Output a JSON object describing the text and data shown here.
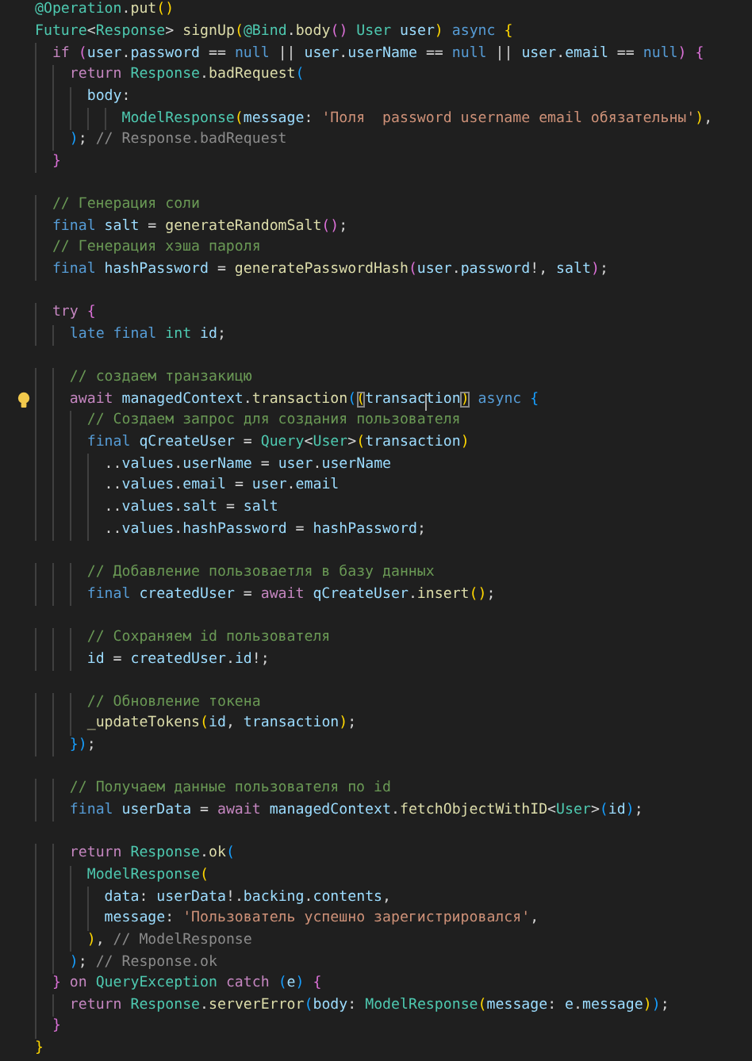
{
  "editor": {
    "lines": [
      {
        "kind": "code",
        "tokens": [
          {
            "text": "@Operation",
            "kind": "ty"
          },
          {
            "text": ".",
            "kind": "p"
          },
          {
            "text": "put",
            "kind": "fn"
          },
          {
            "text": "()",
            "kind": "b1"
          }
        ]
      },
      {
        "kind": "code",
        "tokens": [
          {
            "text": "Future",
            "kind": "ty"
          },
          {
            "text": "<",
            "kind": "p"
          },
          {
            "text": "Response",
            "kind": "ty"
          },
          {
            "text": "> ",
            "kind": "p"
          },
          {
            "text": "signUp",
            "kind": "fn"
          },
          {
            "text": "(",
            "kind": "b1"
          },
          {
            "text": "@Bind",
            "kind": "ty"
          },
          {
            "text": ".",
            "kind": "p"
          },
          {
            "text": "body",
            "kind": "fn"
          },
          {
            "text": "()",
            "kind": "b2"
          },
          {
            "text": " User",
            "kind": "ty"
          },
          {
            "text": " user",
            "kind": "var"
          },
          {
            "text": ")",
            "kind": "b1"
          },
          {
            "text": " async",
            "kind": "st"
          },
          {
            "text": " {",
            "kind": "b1"
          }
        ]
      },
      {
        "kind": "code",
        "tokens": [
          {
            "text": "  if",
            "kind": "kw"
          },
          {
            "text": " (",
            "kind": "b2"
          },
          {
            "text": "user",
            "kind": "var"
          },
          {
            "text": ".",
            "kind": "p"
          },
          {
            "text": "password",
            "kind": "var"
          },
          {
            "text": " ==",
            "kind": "p"
          },
          {
            "text": " null",
            "kind": "st"
          },
          {
            "text": " ||",
            "kind": "p"
          },
          {
            "text": " user",
            "kind": "var"
          },
          {
            "text": ".",
            "kind": "p"
          },
          {
            "text": "userName",
            "kind": "var"
          },
          {
            "text": " ==",
            "kind": "p"
          },
          {
            "text": " null",
            "kind": "st"
          },
          {
            "text": " ||",
            "kind": "p"
          },
          {
            "text": " user",
            "kind": "var"
          },
          {
            "text": ".",
            "kind": "p"
          },
          {
            "text": "email",
            "kind": "var"
          },
          {
            "text": " ==",
            "kind": "p"
          },
          {
            "text": " null",
            "kind": "st"
          },
          {
            "text": ")",
            "kind": "b2"
          },
          {
            "text": " {",
            "kind": "b2"
          }
        ]
      },
      {
        "kind": "code",
        "tokens": [
          {
            "text": "    return",
            "kind": "kw"
          },
          {
            "text": " Response",
            "kind": "ty"
          },
          {
            "text": ".",
            "kind": "p"
          },
          {
            "text": "badRequest",
            "kind": "fn"
          },
          {
            "text": "(",
            "kind": "b3"
          }
        ]
      },
      {
        "kind": "code",
        "tokens": [
          {
            "text": "      body",
            "kind": "var"
          },
          {
            "text": ":",
            "kind": "p"
          }
        ]
      },
      {
        "kind": "code",
        "tokens": [
          {
            "text": "          ModelResponse",
            "kind": "ty"
          },
          {
            "text": "(",
            "kind": "b1"
          },
          {
            "text": "message",
            "kind": "var"
          },
          {
            "text": ":",
            "kind": "p"
          },
          {
            "text": " 'Поля  password username email обязательны'",
            "kind": "str"
          },
          {
            "text": ")",
            "kind": "b1"
          },
          {
            "text": ",",
            "kind": "p"
          }
        ]
      },
      {
        "kind": "code",
        "tokens": [
          {
            "text": "    )",
            "kind": "b3"
          },
          {
            "text": ";",
            "kind": "p"
          },
          {
            "text": " // Response.badRequest",
            "kind": "hint"
          }
        ]
      },
      {
        "kind": "code",
        "tokens": [
          {
            "text": "  }",
            "kind": "b2"
          }
        ]
      },
      {
        "kind": "blank"
      },
      {
        "kind": "code",
        "tokens": [
          {
            "text": "  // Генерация соли",
            "kind": "cm"
          }
        ]
      },
      {
        "kind": "code",
        "tokens": [
          {
            "text": "  final",
            "kind": "st"
          },
          {
            "text": " salt",
            "kind": "var"
          },
          {
            "text": " =",
            "kind": "p"
          },
          {
            "text": " generateRandomSalt",
            "kind": "fn"
          },
          {
            "text": "()",
            "kind": "b2"
          },
          {
            "text": ";",
            "kind": "p"
          }
        ]
      },
      {
        "kind": "code",
        "tokens": [
          {
            "text": "  // Генерация хэша пароля",
            "kind": "cm"
          }
        ]
      },
      {
        "kind": "code",
        "tokens": [
          {
            "text": "  final",
            "kind": "st"
          },
          {
            "text": " hashPassword",
            "kind": "var"
          },
          {
            "text": " =",
            "kind": "p"
          },
          {
            "text": " generatePasswordHash",
            "kind": "fn"
          },
          {
            "text": "(",
            "kind": "b2"
          },
          {
            "text": "user",
            "kind": "var"
          },
          {
            "text": ".",
            "kind": "p"
          },
          {
            "text": "password",
            "kind": "var"
          },
          {
            "text": "!,",
            "kind": "p"
          },
          {
            "text": " salt",
            "kind": "var"
          },
          {
            "text": ")",
            "kind": "b2"
          },
          {
            "text": ";",
            "kind": "p"
          }
        ]
      },
      {
        "kind": "blank"
      },
      {
        "kind": "code",
        "tokens": [
          {
            "text": "  try",
            "kind": "kw"
          },
          {
            "text": " {",
            "kind": "b2"
          }
        ]
      },
      {
        "kind": "code",
        "tokens": [
          {
            "text": "    late",
            "kind": "st"
          },
          {
            "text": " final",
            "kind": "st"
          },
          {
            "text": " int",
            "kind": "ty"
          },
          {
            "text": " id",
            "kind": "var"
          },
          {
            "text": ";",
            "kind": "p"
          }
        ]
      },
      {
        "kind": "blank"
      },
      {
        "kind": "code",
        "tokens": [
          {
            "text": "    // создаем транзакицю",
            "kind": "cm"
          }
        ]
      },
      {
        "kind": "code",
        "bulb": true,
        "tokens": [
          {
            "text": "    await",
            "kind": "kw"
          },
          {
            "text": " managedContext",
            "kind": "var"
          },
          {
            "text": ".",
            "kind": "p"
          },
          {
            "text": "transaction",
            "kind": "fn"
          },
          {
            "text": "(",
            "kind": "b3"
          },
          {
            "text": "(",
            "kind": "b1",
            "boxed": true
          },
          {
            "text": "transac",
            "kind": "var",
            "caret_after": true
          },
          {
            "text": "tion",
            "kind": "var"
          },
          {
            "text": ")",
            "kind": "b1",
            "boxed": true
          },
          {
            "text": " async",
            "kind": "st"
          },
          {
            "text": " {",
            "kind": "b3"
          }
        ]
      },
      {
        "kind": "code",
        "tokens": [
          {
            "text": "      // Создаем запрос для создания пользователя",
            "kind": "cm"
          }
        ]
      },
      {
        "kind": "code",
        "tokens": [
          {
            "text": "      final",
            "kind": "st"
          },
          {
            "text": " qCreateUser",
            "kind": "var"
          },
          {
            "text": " =",
            "kind": "p"
          },
          {
            "text": " Query",
            "kind": "ty"
          },
          {
            "text": "<",
            "kind": "p"
          },
          {
            "text": "User",
            "kind": "ty"
          },
          {
            "text": ">",
            "kind": "p"
          },
          {
            "text": "(",
            "kind": "b1"
          },
          {
            "text": "transaction",
            "kind": "var"
          },
          {
            "text": ")",
            "kind": "b1"
          }
        ]
      },
      {
        "kind": "code",
        "tokens": [
          {
            "text": "        ..",
            "kind": "p"
          },
          {
            "text": "values",
            "kind": "var"
          },
          {
            "text": ".",
            "kind": "p"
          },
          {
            "text": "userName",
            "kind": "var"
          },
          {
            "text": " =",
            "kind": "p"
          },
          {
            "text": " user",
            "kind": "var"
          },
          {
            "text": ".",
            "kind": "p"
          },
          {
            "text": "userName",
            "kind": "var"
          }
        ]
      },
      {
        "kind": "code",
        "tokens": [
          {
            "text": "        ..",
            "kind": "p"
          },
          {
            "text": "values",
            "kind": "var"
          },
          {
            "text": ".",
            "kind": "p"
          },
          {
            "text": "email",
            "kind": "var"
          },
          {
            "text": " =",
            "kind": "p"
          },
          {
            "text": " user",
            "kind": "var"
          },
          {
            "text": ".",
            "kind": "p"
          },
          {
            "text": "email",
            "kind": "var"
          }
        ]
      },
      {
        "kind": "code",
        "tokens": [
          {
            "text": "        ..",
            "kind": "p"
          },
          {
            "text": "values",
            "kind": "var"
          },
          {
            "text": ".",
            "kind": "p"
          },
          {
            "text": "salt",
            "kind": "var"
          },
          {
            "text": " =",
            "kind": "p"
          },
          {
            "text": " salt",
            "kind": "var"
          }
        ]
      },
      {
        "kind": "code",
        "tokens": [
          {
            "text": "        ..",
            "kind": "p"
          },
          {
            "text": "values",
            "kind": "var"
          },
          {
            "text": ".",
            "kind": "p"
          },
          {
            "text": "hashPassword",
            "kind": "var"
          },
          {
            "text": " =",
            "kind": "p"
          },
          {
            "text": " hashPassword",
            "kind": "var"
          },
          {
            "text": ";",
            "kind": "p"
          }
        ]
      },
      {
        "kind": "blank"
      },
      {
        "kind": "code",
        "tokens": [
          {
            "text": "      // Добавление пользоваетля в базу данных",
            "kind": "cm"
          }
        ]
      },
      {
        "kind": "code",
        "tokens": [
          {
            "text": "      final",
            "kind": "st"
          },
          {
            "text": " createdUser",
            "kind": "var"
          },
          {
            "text": " =",
            "kind": "p"
          },
          {
            "text": " await",
            "kind": "kw"
          },
          {
            "text": " qCreateUser",
            "kind": "var"
          },
          {
            "text": ".",
            "kind": "p"
          },
          {
            "text": "insert",
            "kind": "fn"
          },
          {
            "text": "()",
            "kind": "b1"
          },
          {
            "text": ";",
            "kind": "p"
          }
        ]
      },
      {
        "kind": "blank"
      },
      {
        "kind": "code",
        "tokens": [
          {
            "text": "      // Сохраняем id пользователя",
            "kind": "cm"
          }
        ]
      },
      {
        "kind": "code",
        "tokens": [
          {
            "text": "      id",
            "kind": "var"
          },
          {
            "text": " =",
            "kind": "p"
          },
          {
            "text": " createdUser",
            "kind": "var"
          },
          {
            "text": ".",
            "kind": "p"
          },
          {
            "text": "id",
            "kind": "var"
          },
          {
            "text": "!;",
            "kind": "p"
          }
        ]
      },
      {
        "kind": "blank"
      },
      {
        "kind": "code",
        "tokens": [
          {
            "text": "      // Обновление токена",
            "kind": "cm"
          }
        ]
      },
      {
        "kind": "code",
        "tokens": [
          {
            "text": "      _updateTokens",
            "kind": "fn"
          },
          {
            "text": "(",
            "kind": "b1"
          },
          {
            "text": "id",
            "kind": "var"
          },
          {
            "text": ",",
            "kind": "p"
          },
          {
            "text": " transaction",
            "kind": "var"
          },
          {
            "text": ")",
            "kind": "b1"
          },
          {
            "text": ";",
            "kind": "p"
          }
        ]
      },
      {
        "kind": "code",
        "tokens": [
          {
            "text": "    }",
            "kind": "b3"
          },
          {
            "text": ")",
            "kind": "b3"
          },
          {
            "text": ";",
            "kind": "p"
          }
        ]
      },
      {
        "kind": "blank"
      },
      {
        "kind": "code",
        "tokens": [
          {
            "text": "    // Получаем данные пользователя по id",
            "kind": "cm"
          }
        ]
      },
      {
        "kind": "code",
        "tokens": [
          {
            "text": "    final",
            "kind": "st"
          },
          {
            "text": " userData",
            "kind": "var"
          },
          {
            "text": " =",
            "kind": "p"
          },
          {
            "text": " await",
            "kind": "kw"
          },
          {
            "text": " managedContext",
            "kind": "var"
          },
          {
            "text": ".",
            "kind": "p"
          },
          {
            "text": "fetchObjectWithID",
            "kind": "fn"
          },
          {
            "text": "<",
            "kind": "p"
          },
          {
            "text": "User",
            "kind": "ty"
          },
          {
            "text": ">",
            "kind": "p"
          },
          {
            "text": "(",
            "kind": "b3"
          },
          {
            "text": "id",
            "kind": "var"
          },
          {
            "text": ")",
            "kind": "b3"
          },
          {
            "text": ";",
            "kind": "p"
          }
        ]
      },
      {
        "kind": "blank"
      },
      {
        "kind": "code",
        "tokens": [
          {
            "text": "    return",
            "kind": "kw"
          },
          {
            "text": " Response",
            "kind": "ty"
          },
          {
            "text": ".",
            "kind": "p"
          },
          {
            "text": "ok",
            "kind": "fn"
          },
          {
            "text": "(",
            "kind": "b3"
          }
        ]
      },
      {
        "kind": "code",
        "tokens": [
          {
            "text": "      ModelResponse",
            "kind": "ty"
          },
          {
            "text": "(",
            "kind": "b1"
          }
        ]
      },
      {
        "kind": "code",
        "tokens": [
          {
            "text": "        data",
            "kind": "var"
          },
          {
            "text": ":",
            "kind": "p"
          },
          {
            "text": " userData",
            "kind": "var"
          },
          {
            "text": "!.",
            "kind": "p"
          },
          {
            "text": "backing",
            "kind": "var"
          },
          {
            "text": ".",
            "kind": "p"
          },
          {
            "text": "contents",
            "kind": "var"
          },
          {
            "text": ",",
            "kind": "p"
          }
        ]
      },
      {
        "kind": "code",
        "tokens": [
          {
            "text": "        message",
            "kind": "var"
          },
          {
            "text": ":",
            "kind": "p"
          },
          {
            "text": " 'Пользователь успешно зарегистрировался'",
            "kind": "str"
          },
          {
            "text": ",",
            "kind": "p"
          }
        ]
      },
      {
        "kind": "code",
        "tokens": [
          {
            "text": "      )",
            "kind": "b1"
          },
          {
            "text": ",",
            "kind": "p"
          },
          {
            "text": " // ModelResponse",
            "kind": "hint"
          }
        ]
      },
      {
        "kind": "code",
        "tokens": [
          {
            "text": "    )",
            "kind": "b3"
          },
          {
            "text": ";",
            "kind": "p"
          },
          {
            "text": " // Response.ok",
            "kind": "hint"
          }
        ]
      },
      {
        "kind": "code",
        "tokens": [
          {
            "text": "  }",
            "kind": "b2"
          },
          {
            "text": " on",
            "kind": "kw"
          },
          {
            "text": " QueryException",
            "kind": "ty"
          },
          {
            "text": " catch",
            "kind": "kw"
          },
          {
            "text": " (",
            "kind": "b3"
          },
          {
            "text": "e",
            "kind": "var"
          },
          {
            "text": ")",
            "kind": "b3"
          },
          {
            "text": " {",
            "kind": "b2"
          }
        ]
      },
      {
        "kind": "code",
        "tokens": [
          {
            "text": "    return",
            "kind": "kw"
          },
          {
            "text": " Response",
            "kind": "ty"
          },
          {
            "text": ".",
            "kind": "p"
          },
          {
            "text": "serverError",
            "kind": "fn"
          },
          {
            "text": "(",
            "kind": "b3"
          },
          {
            "text": "body",
            "kind": "var"
          },
          {
            "text": ":",
            "kind": "p"
          },
          {
            "text": " ModelResponse",
            "kind": "ty"
          },
          {
            "text": "(",
            "kind": "b1"
          },
          {
            "text": "message",
            "kind": "var"
          },
          {
            "text": ":",
            "kind": "p"
          },
          {
            "text": " e",
            "kind": "var"
          },
          {
            "text": ".",
            "kind": "p"
          },
          {
            "text": "message",
            "kind": "var"
          },
          {
            "text": ")",
            "kind": "b1"
          },
          {
            "text": ")",
            "kind": "b3"
          },
          {
            "text": ";",
            "kind": "p"
          }
        ]
      },
      {
        "kind": "code",
        "tokens": [
          {
            "text": "  }",
            "kind": "b2"
          }
        ]
      },
      {
        "kind": "code",
        "tokens": [
          {
            "text": "}",
            "kind": "b1"
          }
        ]
      }
    ]
  }
}
